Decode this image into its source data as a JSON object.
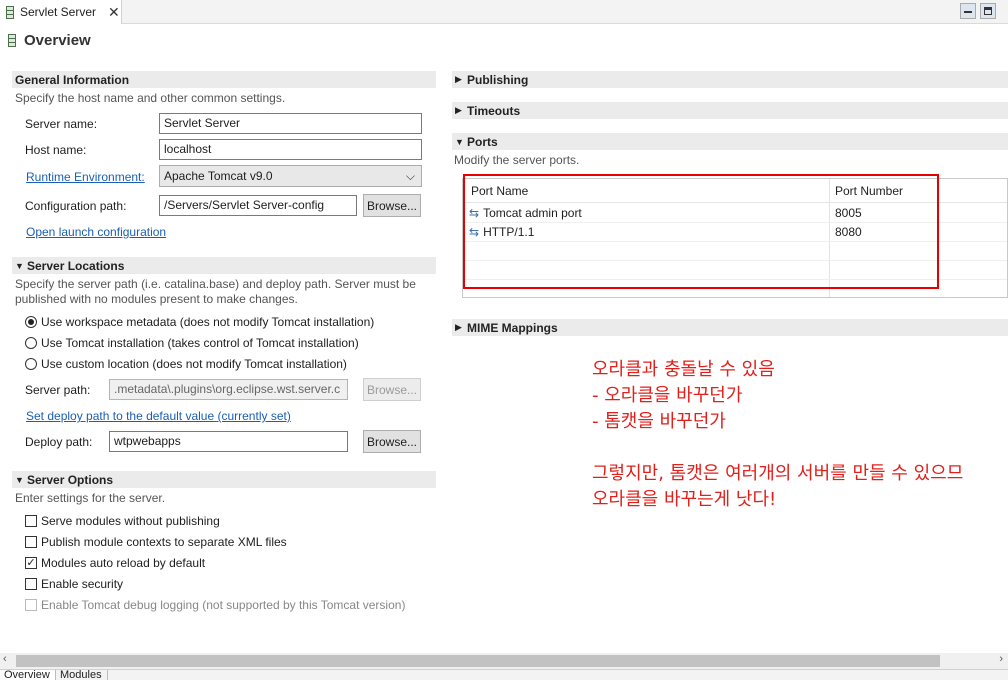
{
  "editor_tab": {
    "label": "Servlet Server",
    "close": "✕"
  },
  "heading": {
    "title": "Overview"
  },
  "general": {
    "title": "General Information",
    "desc": "Specify the host name and other common settings.",
    "server_name_label": "Server name:",
    "server_name_value": "Servlet Server",
    "host_name_label": "Host name:",
    "host_name_value": "localhost",
    "runtime_label": "Runtime Environment:",
    "runtime_value": "Apache Tomcat v9.0",
    "config_label": "Configuration path:",
    "config_value": "/Servers/Servlet Server-config",
    "browse": "Browse...",
    "open_launch": "Open launch configuration"
  },
  "locations": {
    "title": "Server Locations",
    "desc_1": "Specify the server path (i.e. catalina.base) and deploy path. Server must be",
    "desc_2": "published with no modules present to make changes.",
    "radios": [
      {
        "label": "Use workspace metadata (does not modify Tomcat installation)",
        "checked": true
      },
      {
        "label": "Use Tomcat installation (takes control of Tomcat installation)",
        "checked": false
      },
      {
        "label": "Use custom location (does not modify Tomcat installation)",
        "checked": false
      }
    ],
    "server_path_label": "Server path:",
    "server_path_value": ".metadata\\.plugins\\org.eclipse.wst.server.c",
    "set_deploy": "Set deploy path to the default value (currently set)",
    "deploy_label": "Deploy path:",
    "deploy_value": "wtpwebapps",
    "browse": "Browse..."
  },
  "options": {
    "title": "Server Options",
    "desc": "Enter settings for the server.",
    "checks": [
      {
        "label": "Serve modules without publishing",
        "checked": false,
        "enabled": true
      },
      {
        "label": "Publish module contexts to separate XML files",
        "checked": false,
        "enabled": true
      },
      {
        "label": "Modules auto reload by default",
        "checked": true,
        "enabled": true
      },
      {
        "label": "Enable security",
        "checked": false,
        "enabled": true
      },
      {
        "label": "Enable Tomcat debug logging (not supported by this Tomcat version)",
        "checked": false,
        "enabled": false
      }
    ]
  },
  "right": {
    "publishing": "Publishing",
    "timeouts": "Timeouts",
    "ports_title": "Ports",
    "ports_desc": "Modify the server ports.",
    "col_name": "Port Name",
    "col_number": "Port Number",
    "ports": [
      {
        "name": "Tomcat admin port",
        "number": "8005"
      },
      {
        "name": "HTTP/1.1",
        "number": "8080"
      }
    ],
    "mime": "MIME Mappings"
  },
  "annotation": {
    "line1": "오라클과 충돌날 수 있음",
    "line2": "- 오라클을 바꾸던가",
    "line3": "- 톰캣을 바꾸던가",
    "line4": "그렇지만, 톰캣은 여러개의 서버를 만들 수 있으므",
    "line5": "오라클을 바꾸는게 낫다!"
  },
  "bottom_tabs": [
    "Overview",
    "Modules"
  ],
  "colors": {
    "link": "#1a5fb4",
    "annotation": "#e0201b",
    "highlight_box": "#e60000"
  }
}
